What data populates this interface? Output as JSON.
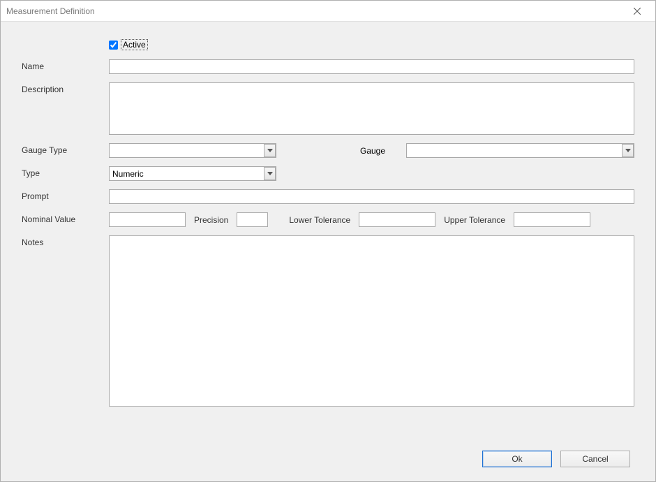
{
  "titlebar": {
    "title": "Measurement Definition"
  },
  "form": {
    "active_label": "Active",
    "active_checked": true,
    "name_label": "Name",
    "name_value": "",
    "description_label": "Description",
    "description_value": "",
    "gauge_type_label": "Gauge Type",
    "gauge_type_value": "",
    "gauge_label": "Gauge",
    "gauge_value": "",
    "type_label": "Type",
    "type_value": "Numeric",
    "prompt_label": "Prompt",
    "prompt_value": "",
    "nominal_value_label": "Nominal Value",
    "nominal_value": "",
    "precision_label": "Precision",
    "precision_value": "",
    "lower_tolerance_label": "Lower Tolerance",
    "lower_tolerance_value": "",
    "upper_tolerance_label": "Upper Tolerance",
    "upper_tolerance_value": "",
    "notes_label": "Notes",
    "notes_value": ""
  },
  "buttons": {
    "ok": "Ok",
    "cancel": "Cancel"
  }
}
